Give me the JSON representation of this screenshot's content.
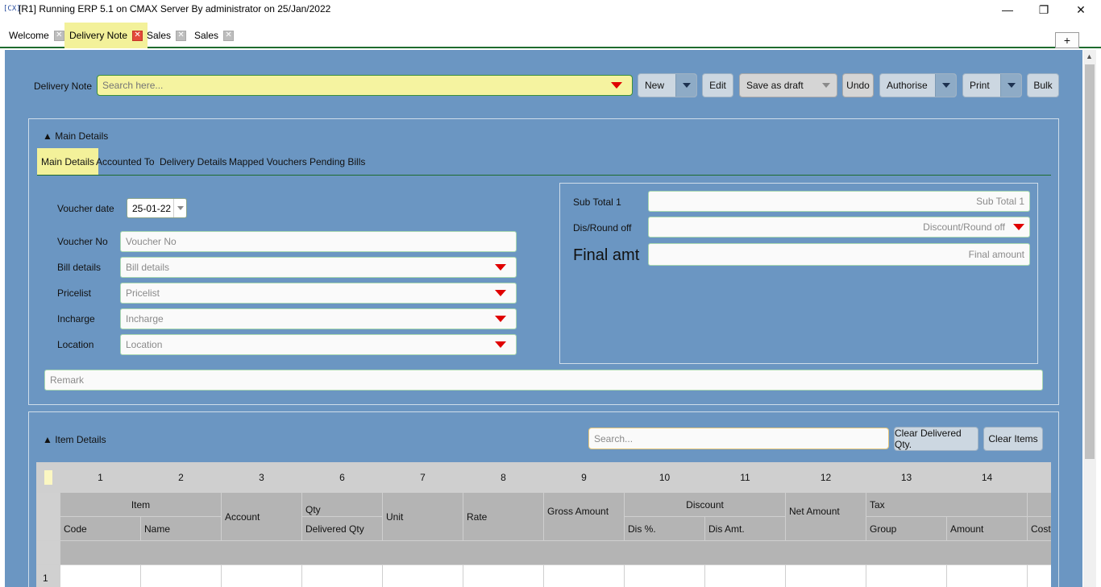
{
  "window": {
    "app_icon": "[CX]",
    "title": "[R1] Running ERP 5.1 on CMAX Server By administrator on 25/Jan/2022",
    "minimize": "—",
    "restore": "❐",
    "close": "✕"
  },
  "tabs": [
    {
      "label": "Welcome",
      "close": "✕"
    },
    {
      "label": "Delivery Note",
      "close": "✕"
    },
    {
      "label": "Sales",
      "close": "✕"
    },
    {
      "label": "Sales",
      "close": "✕"
    }
  ],
  "new_tab": "+",
  "toolbar": {
    "label": "Delivery Note",
    "search_placeholder": "Search here...",
    "new": "New",
    "edit": "Edit",
    "save_as_draft": "Save as draft",
    "undo": "Undo",
    "authorise": "Authorise",
    "print": "Print",
    "bulk": "Bulk"
  },
  "main_details": {
    "section_title": "▲ Main Details",
    "tabs": [
      "Main Details",
      "Accounted To",
      "Delivery Details",
      "Mapped Vouchers",
      "Pending Bills"
    ],
    "voucher_date_label": "Voucher date",
    "voucher_date": "25-01-22",
    "voucher_no_label": "Voucher No",
    "voucher_no_placeholder": "Voucher No",
    "bill_details_label": "Bill details",
    "bill_details_placeholder": "Bill details",
    "pricelist_label": "Pricelist",
    "pricelist_placeholder": "Pricelist",
    "incharge_label": "Incharge",
    "incharge_placeholder": "Incharge",
    "location_label": "Location",
    "location_placeholder": "Location",
    "remark_placeholder": "Remark"
  },
  "summary": {
    "subtotal_label": "Sub Total 1",
    "subtotal_placeholder": "Sub Total 1",
    "dis_label": "Dis/Round off",
    "dis_placeholder": "Discount/Round off",
    "final_label": "Final amt",
    "final_placeholder": "Final amount"
  },
  "item_details": {
    "section_title": "▲ Item Details",
    "search_placeholder": "Search...",
    "clear_delivered": "Clear Delivered Qty.",
    "clear_items": "Clear Items",
    "column_numbers": [
      "1",
      "2",
      "3",
      "6",
      "7",
      "8",
      "9",
      "10",
      "11",
      "12",
      "13",
      "14"
    ],
    "headers": {
      "item": "Item",
      "code": "Code",
      "name": "Name",
      "account": "Account",
      "qty": "Qty",
      "delivered_qty": "Delivered Qty",
      "unit": "Unit",
      "rate": "Rate",
      "gross_amount": "Gross Amount",
      "discount": "Discount",
      "dis_pct": "Dis %.",
      "dis_amt": "Dis Amt.",
      "net_amount": "Net Amount",
      "tax": "Tax",
      "group": "Group",
      "amount": "Amount",
      "cost": "Cost"
    },
    "rows": [
      "1"
    ]
  }
}
